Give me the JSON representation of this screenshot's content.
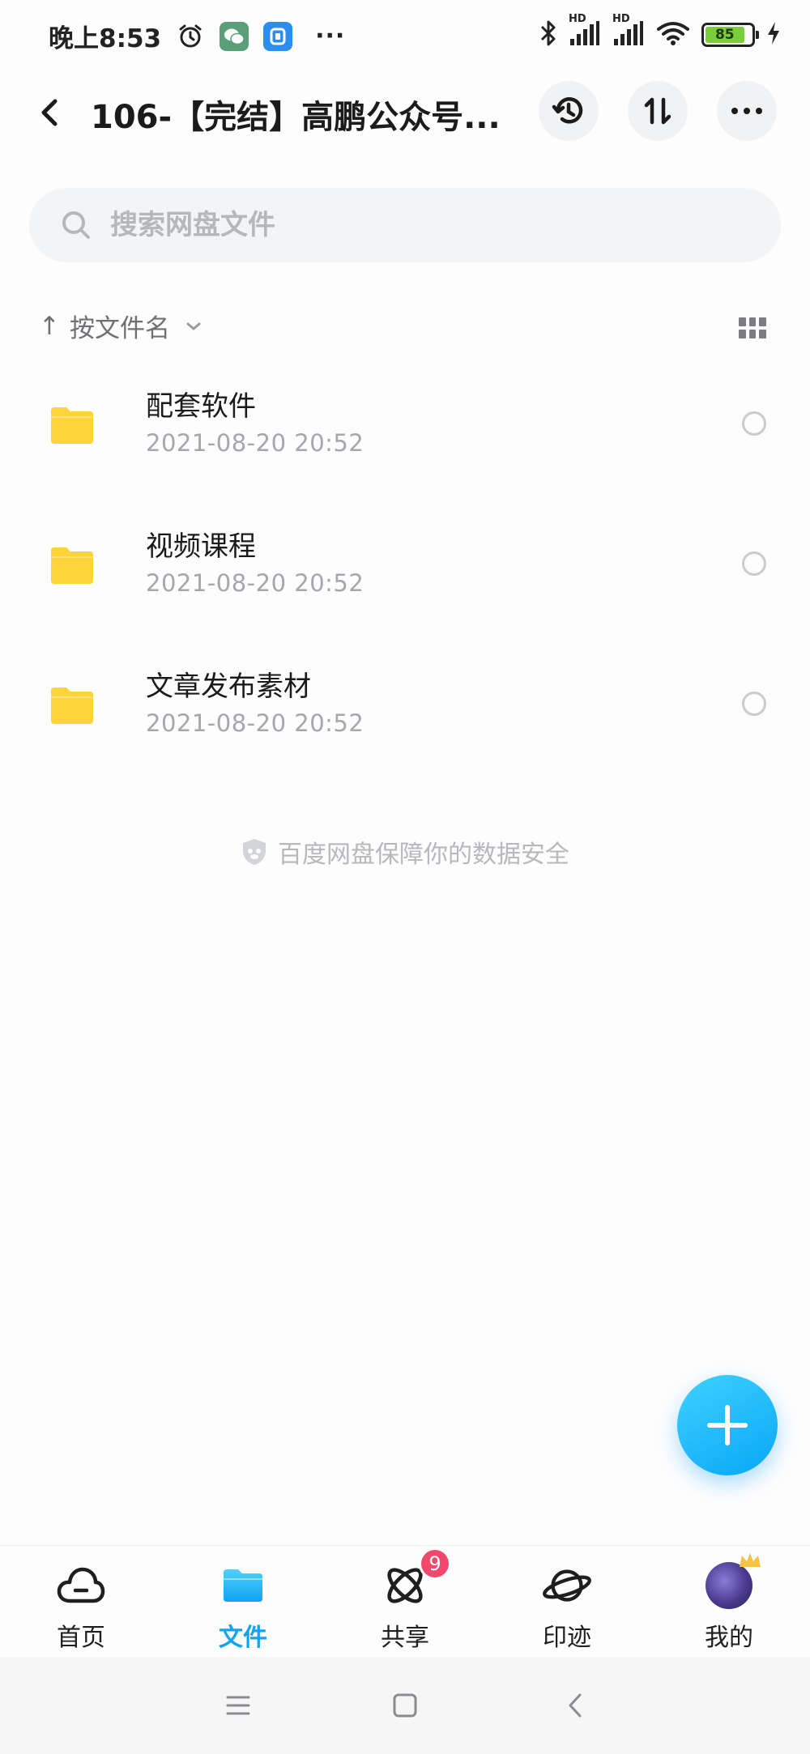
{
  "status_bar": {
    "time": "晚上8:53",
    "more": "···",
    "battery": "85",
    "hd1": "HD",
    "hd2": "HD"
  },
  "header": {
    "title": "106-【完结】高鹏公众号..."
  },
  "search": {
    "placeholder": "搜索网盘文件"
  },
  "sort": {
    "arrow": "↑",
    "label": "按文件名"
  },
  "files": [
    {
      "name": "配套软件",
      "date": "2021-08-20  20:52"
    },
    {
      "name": "视频课程",
      "date": "2021-08-20  20:52"
    },
    {
      "name": "文章发布素材",
      "date": "2021-08-20  20:52"
    }
  ],
  "safe_note": "百度网盘保障你的数据安全",
  "tabbar": {
    "items": [
      {
        "label": "首页",
        "icon": "cloud-home-icon"
      },
      {
        "label": "文件",
        "icon": "folder-icon"
      },
      {
        "label": "共享",
        "icon": "orbit-share-icon",
        "badge": "9"
      },
      {
        "label": "印迹",
        "icon": "planet-icon"
      },
      {
        "label": "我的",
        "icon": "avatar"
      }
    ],
    "active": "文件"
  },
  "colors": {
    "accent": "#12a3f2",
    "folder": "#ffd43b",
    "badge": "#f2486b",
    "battery_fill": "#7ccd3c"
  }
}
